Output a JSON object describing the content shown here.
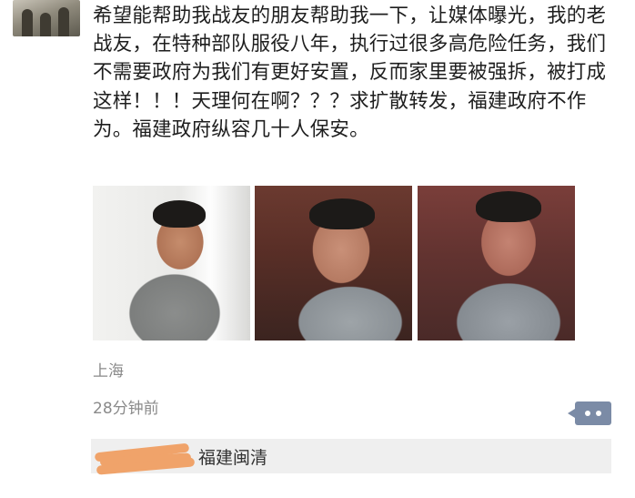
{
  "post": {
    "text": "希望能帮助我战友的朋友帮助我一下，让媒体曝光，我的老战友，在特种部队服役八年，执行过很多高危险任务，我们不需要政府为我们有更好安置，反而家里要被强拆，被打成这样！！！天理何在啊？？？求扩散转发，福建政府不作为。福建政府纵容几十人保安。",
    "location": "上海",
    "time": "28分钟前"
  },
  "comment": {
    "text": "福建闽清"
  },
  "colors": {
    "meta_text": "#8a8a8a",
    "comment_button": "#7b8ba6",
    "comment_bg": "#efefef",
    "redaction": "#f0a36a"
  },
  "icons": {
    "comment_button": "ellipsis-comment-icon"
  }
}
